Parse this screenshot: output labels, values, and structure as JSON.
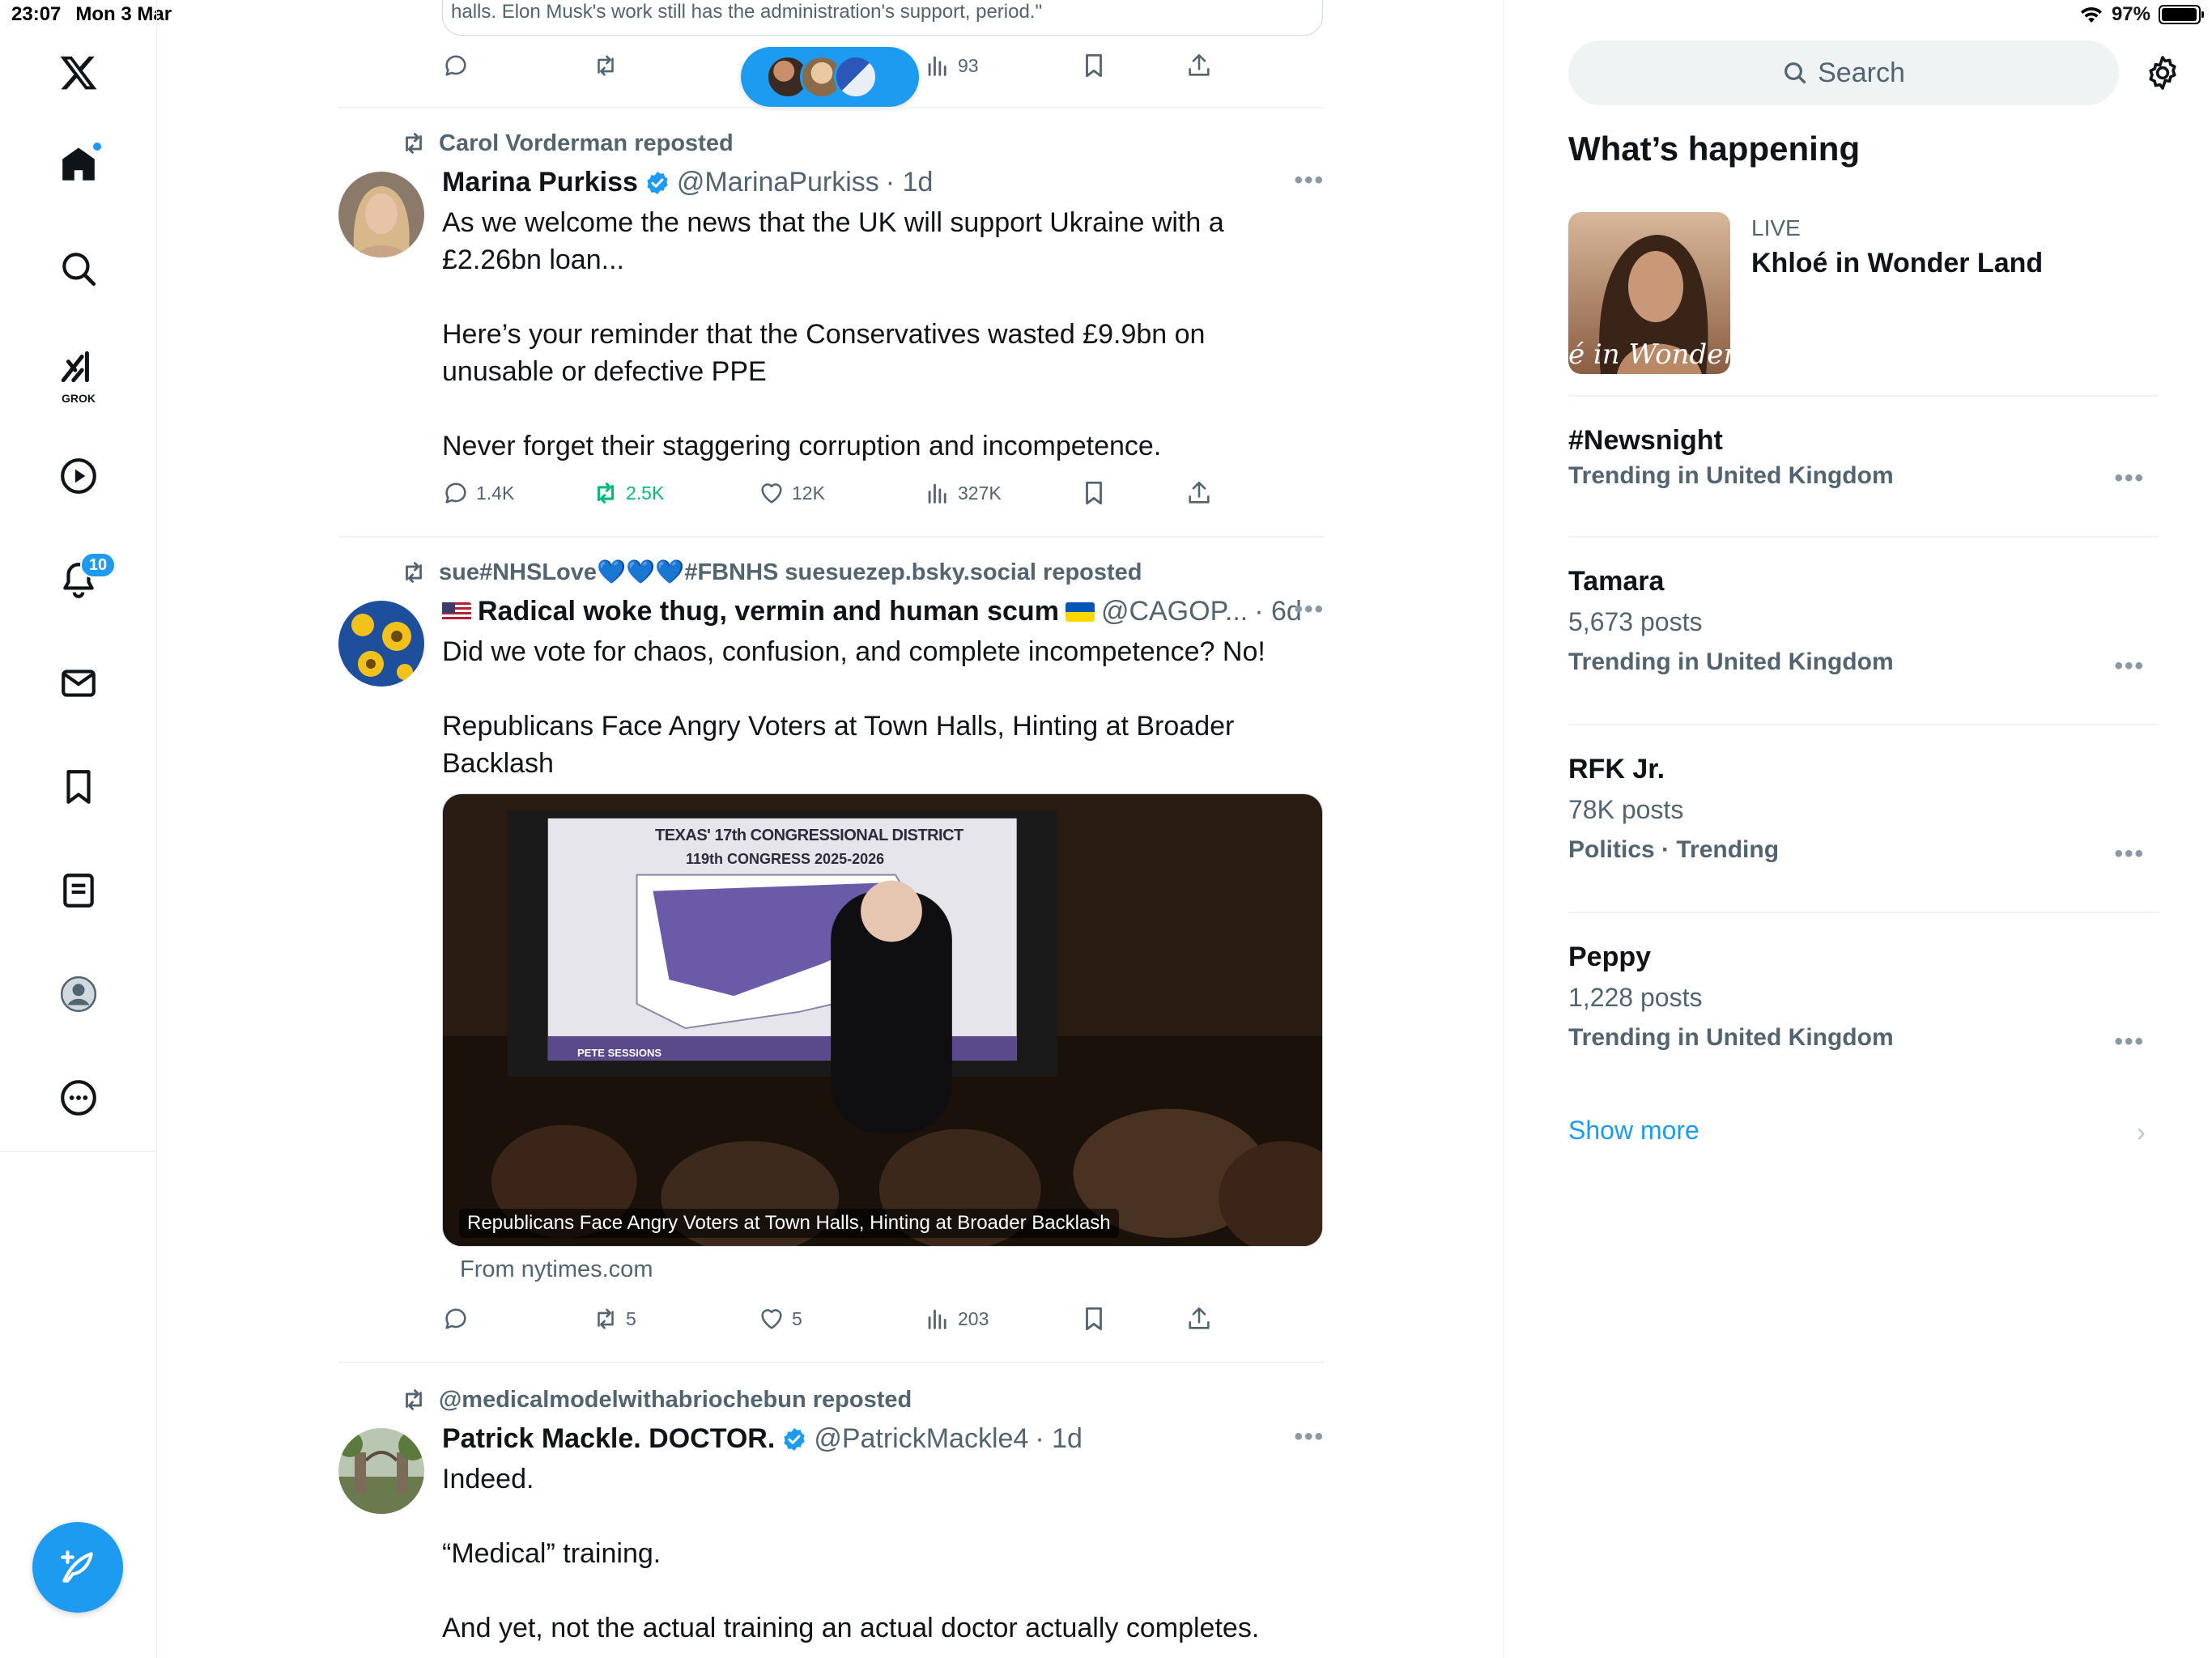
{
  "status_bar": {
    "time": "23:07",
    "date": "Mon 3 Mar",
    "battery": "97%",
    "battery_level": 0.97
  },
  "nav": {
    "grok_label": "GROK",
    "notifications_badge": "10",
    "icons": [
      "x-logo-icon",
      "home-icon",
      "search-icon",
      "grok-icon",
      "video-icon",
      "bell-icon",
      "mail-icon",
      "bookmark-icon",
      "lists-icon",
      "profile-icon",
      "more-icon"
    ]
  },
  "top_post": {
    "quote_text": "halls. Elon Musk's work still has the administration's support, period.\"",
    "views": "93"
  },
  "posts": [
    {
      "reposted_by": "Carol Vorderman reposted",
      "display_name": "Marina Purkiss",
      "handle": "@MarinaPurkiss",
      "time": "· 1d",
      "text": "As we welcome the news that the UK will support Ukraine with a £2.26bn loan...\n\nHere’s your reminder that the Conservatives wasted £9.9bn on unusable or defective PPE\n\nNever forget their staggering corruption and incompetence.",
      "replies": "1.4K",
      "reposts": "2.5K",
      "likes": "12K",
      "views": "327K"
    },
    {
      "reposted_by_prefix": "sue#NHSLove",
      "reposted_by_hearts": "💙💙💙",
      "reposted_by_suffix": "#FBNHS suesuezep.bsky.social reposted",
      "display_name": "Radical woke thug, vermin and human scum",
      "handle": "@CAGOP...",
      "time": "· 6d",
      "text": "Did we vote for chaos, confusion, and complete incompetence? No!\n\nRepublicans Face Angry Voters at Town Halls, Hinting at Broader Backlash",
      "media_caption": "Republicans Face Angry Voters at Town Halls, Hinting at Broader Backlash",
      "media_slide_title_1": "TEXAS' 17th CONGRESSIONAL DISTRICT",
      "media_slide_title_2": "119th CONGRESS 2025-2026",
      "media_slide_footer": "PETE SESSIONS",
      "link_source": "From nytimes.com",
      "replies": "",
      "reposts": "5",
      "likes": "5",
      "views": "203"
    },
    {
      "reposted_by": "@medicalmodelwithabriochebun reposted",
      "display_name": "Patrick Mackle. DOCTOR.",
      "handle": "@PatrickMackle4",
      "time": "· 1d",
      "text": "Indeed.\n\n“Medical” training.\n\nAnd yet, not the actual training an actual doctor actually completes."
    }
  ],
  "sidebar": {
    "search_placeholder": "Search",
    "whats_happening": "What’s happening",
    "live": {
      "label": "LIVE",
      "title": "Khloé in Wonder Land",
      "thumb_text": "é in Wonder I"
    },
    "trends": [
      {
        "name": "#Newsnight",
        "count": "",
        "context": "Trending in United Kingdom"
      },
      {
        "name": "Tamara",
        "count": "5,673 posts",
        "context": "Trending in United Kingdom"
      },
      {
        "name": "RFK Jr.",
        "count": "78K posts",
        "context": "Politics · Trending"
      },
      {
        "name": "Peppy",
        "count": "1,228 posts",
        "context": "Trending in United Kingdom"
      }
    ],
    "show_more": "Show more"
  },
  "colors": {
    "accent": "#1d9bf0",
    "repost_active": "#00ba7c",
    "muted": "#536471"
  }
}
